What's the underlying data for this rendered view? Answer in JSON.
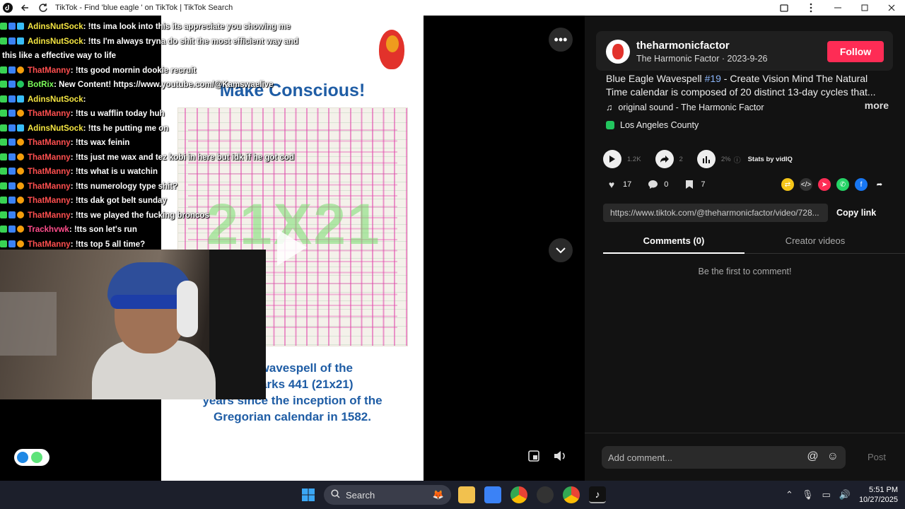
{
  "window": {
    "title": "TikTok - Find 'blue eagle ' on TikTok | TikTok Search"
  },
  "poster": {
    "title": "Make Conscious!",
    "grid_label": "21X21",
    "caption_line1": "ngle wavespell of the",
    "caption_line2": "on marks 441 (21x21)",
    "caption_line3": "years since the inception of the",
    "caption_line4": "Gregorian calendar in 1582."
  },
  "chat": [
    {
      "user": "AdinsNutSock",
      "color": "yellow",
      "text": ": !tts ima look into this its appreciate you showing me"
    },
    {
      "user": "AdinsNutSock",
      "color": "yellow",
      "text": ": !tts I'm always tryna do shit the most efficient way and"
    },
    {
      "user": "",
      "color": "",
      "text": "this like a effective way to life"
    },
    {
      "user": "ThatManny",
      "color": "red",
      "text": ": !tts good mornin dookie recruit"
    },
    {
      "user": "BotRix",
      "color": "green",
      "text": ": New Content! https://www.youtube.com/@Kamswaelive"
    },
    {
      "user": "AdinsNutSock",
      "color": "yellow",
      "text": ":"
    },
    {
      "user": "ThatManny",
      "color": "red",
      "text": ": !tts u wafflin today huh"
    },
    {
      "user": "AdinsNutSock",
      "color": "yellow",
      "text": ": !tts he putting me on"
    },
    {
      "user": "ThatManny",
      "color": "red",
      "text": ": !tts wax feinin"
    },
    {
      "user": "ThatManny",
      "color": "red",
      "text": ": !tts just me wax and tez kobi in here but idk if he got cod"
    },
    {
      "user": "ThatManny",
      "color": "red",
      "text": ": !tts what is u watchin"
    },
    {
      "user": "ThatManny",
      "color": "red",
      "text": ": !tts numerology type shit?"
    },
    {
      "user": "ThatManny",
      "color": "red",
      "text": ": !tts dak got belt sunday"
    },
    {
      "user": "ThatManny",
      "color": "red",
      "text": ": !tts we played the fucking broncos"
    },
    {
      "user": "Trackhvwk",
      "color": "pink",
      "text": ": !tts son let's run"
    },
    {
      "user": "ThatManny",
      "color": "red",
      "text": ": !tts top 5 all time?"
    }
  ],
  "author": {
    "handle": "theharmonicfactor",
    "sub": "The Harmonic Factor · 2023-9-26",
    "follow_label": "Follow"
  },
  "description": {
    "prefix": "Blue Eagle Wavespell ",
    "hashtag": "#19",
    "body": " - Create Vision Mind The Natural Time calendar is composed of 20 distinct 13-day cycles that...",
    "more_label": "more"
  },
  "music": "original sound - The Harmonic Factor",
  "location": "Los Angeles County",
  "stats": {
    "plays": "1.2K",
    "shares": "2",
    "rate": "2%",
    "stats_by": "Stats by vidIQ"
  },
  "actions": {
    "likes": "17",
    "comments": "0",
    "saves": "7"
  },
  "link": {
    "url": "https://www.tiktok.com/@theharmonicfactor/video/728...",
    "copy_label": "Copy link"
  },
  "tabs": [
    "Comments (0)",
    "Creator videos"
  ],
  "empty_comments": "Be the first to comment!",
  "comment_bar": {
    "placeholder": "Add comment...",
    "post_label": "Post"
  },
  "taskbar": {
    "search_label": "Search",
    "time": "5:51 PM",
    "date": "10/27/2025"
  },
  "colors": {
    "follow": "#fe2c55",
    "panel_bg": "#121212",
    "poster_text": "#1f5da5"
  }
}
